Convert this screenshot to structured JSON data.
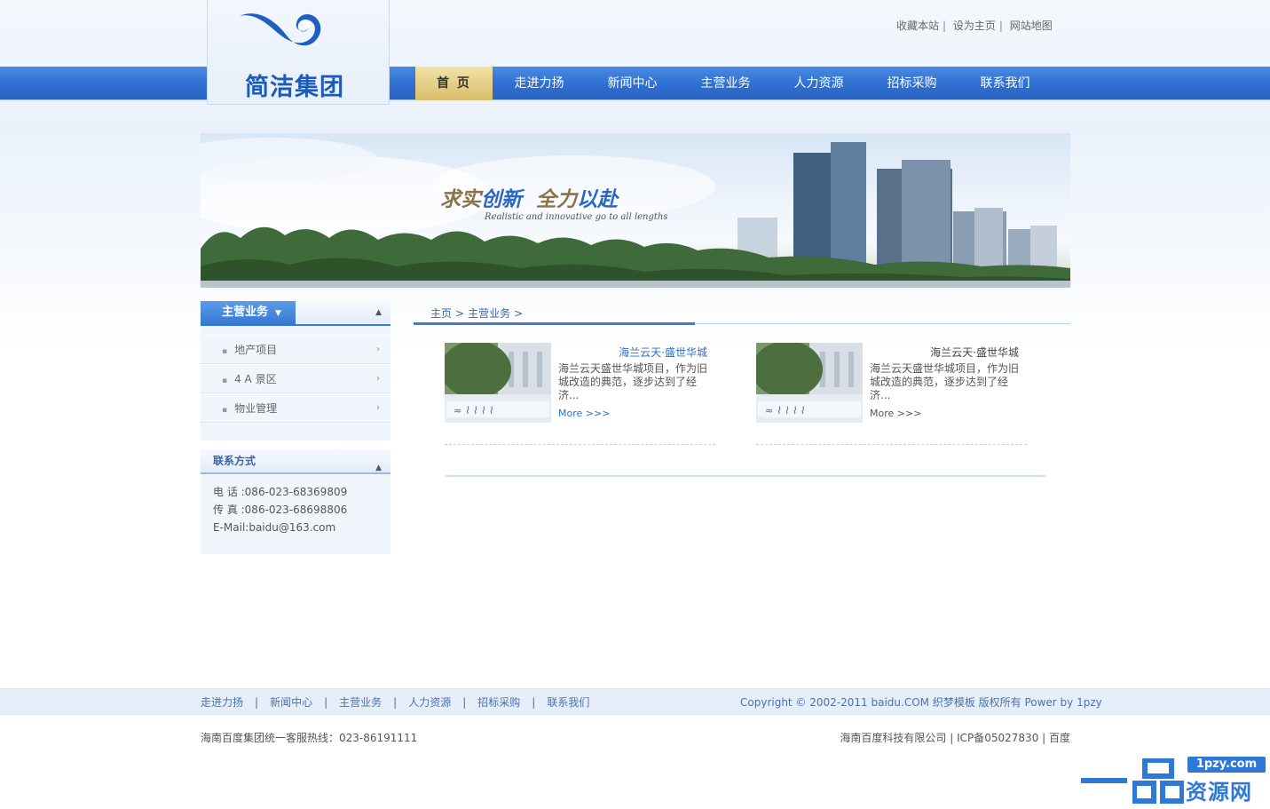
{
  "header": {
    "logo_text": "简洁集团",
    "top_links": [
      "收藏本站",
      "设为主页",
      "网站地图"
    ],
    "top_link_sep": "|",
    "nav": [
      {
        "label": "首 页",
        "active": true
      },
      {
        "label": "走进力扬"
      },
      {
        "label": "新闻中心"
      },
      {
        "label": "主营业务"
      },
      {
        "label": "人力资源"
      },
      {
        "label": "招标采购"
      },
      {
        "label": "联系我们"
      }
    ]
  },
  "banner": {
    "slogan_a": "求实",
    "slogan_b": "创新",
    "slogan_c": "全力",
    "slogan_d": "以赴",
    "slogan_en": "Realistic and innovative go to all lengths"
  },
  "sidebar": {
    "title": "主营业务",
    "items": [
      {
        "label": "地产项目"
      },
      {
        "label": "4 A 景区"
      },
      {
        "label": "物业管理"
      }
    ],
    "bullet": "▪",
    "arrow": "›",
    "caret": "▼",
    "collapse": "▲"
  },
  "contact": {
    "title": "联系方式",
    "phone": "电 话 :086-023-68369809",
    "fax": "传 真 :086-023-68698806",
    "email": "E-Mail:baidu@163.com"
  },
  "breadcrumb": {
    "home": "主页",
    "current": "主营业务",
    "sep": ">"
  },
  "products": [
    {
      "title": "海兰云天·盛世华城",
      "desc": "海兰云天盛世华城项目，作为旧城改造的典范，逐步达到了经济...",
      "more": "More >>>",
      "title_color": "#2f6fc4",
      "more_color": "#2f6fc4"
    },
    {
      "title": "海兰云天·盛世华城",
      "desc": "海兰云天盛世华城项目，作为旧城改造的典范，逐步达到了经济...",
      "more": "More >>>",
      "title_color": "#444444",
      "more_color": "#555555"
    }
  ],
  "footer": {
    "links": [
      "走进力扬",
      "新闻中心",
      "主营业务",
      "人力资源",
      "招标采购",
      "联系我们"
    ],
    "sep": "|",
    "copyright": "Copyright © 2002-2011 baidu.COM 织梦模板 版权所有 Power by 1pzy",
    "hotline": "海南百度集团统一客服热线：023-86191111",
    "company": "海南百度科技有限公司 | ICP备05027830 | 百度"
  },
  "watermark": {
    "url": "1pzy.com",
    "text": "资源网"
  },
  "colors": {
    "nav_blue": "#2f6fd0",
    "active_gold": "#d9bd6a",
    "link_blue": "#3a66a8"
  }
}
